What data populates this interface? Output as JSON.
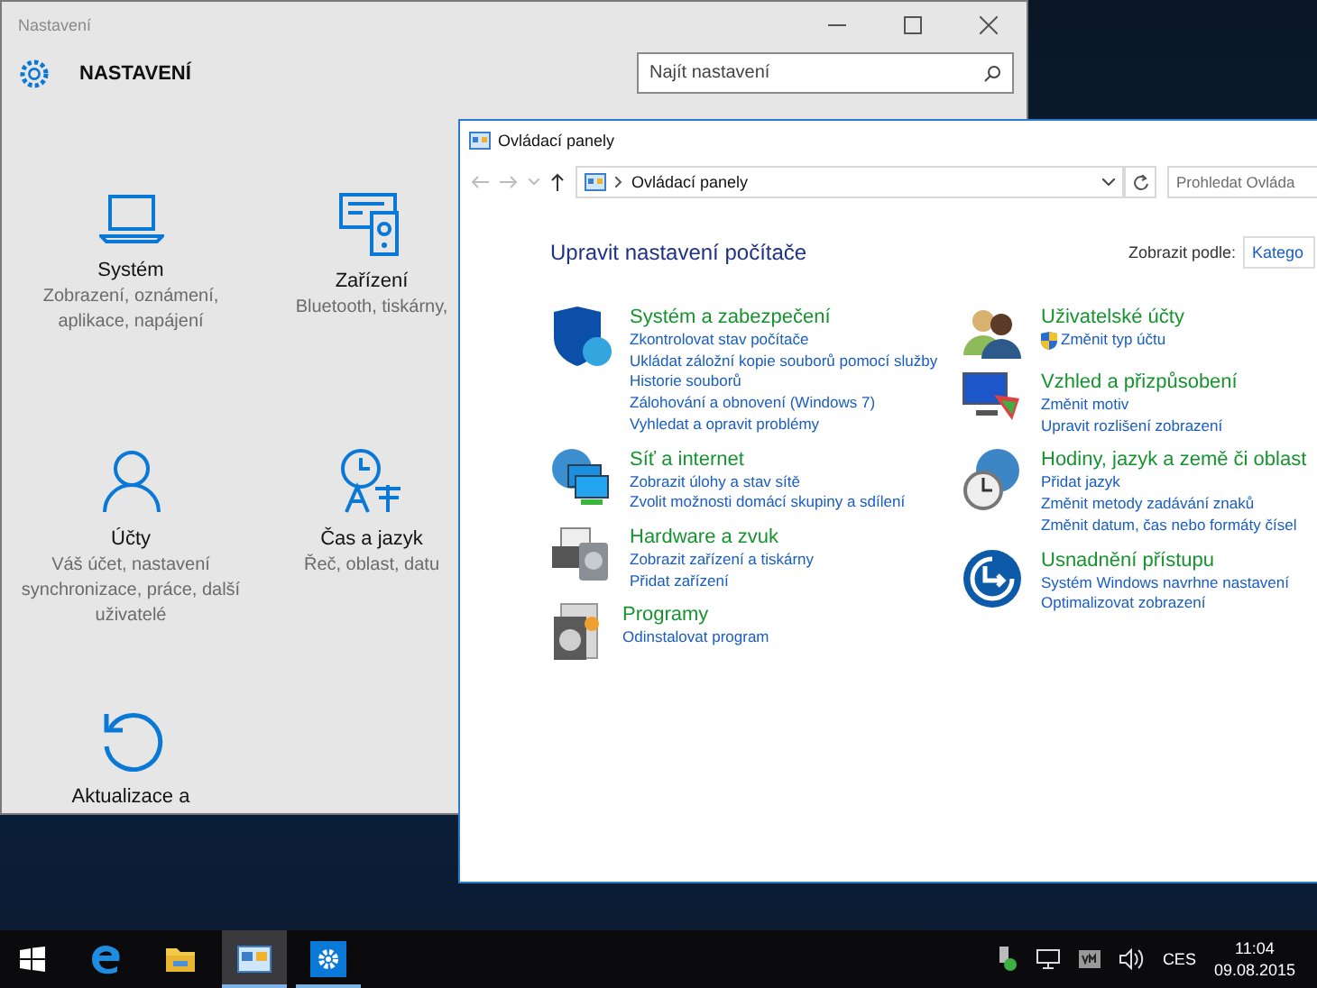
{
  "settings_window": {
    "title": "Nastavení",
    "header_title": "NASTAVENÍ",
    "search_placeholder": "Najít nastavení",
    "tiles": [
      {
        "title": "Systém",
        "description": "Zobrazení, oznámení, aplikace, napájení"
      },
      {
        "title": "Zařízení",
        "description": "Bluetooth, tiskárny,"
      },
      {
        "title": "Účty",
        "description": "Váš účet, nastavení synchronizace, práce, další uživatelé"
      },
      {
        "title": "Čas a jazyk",
        "description": "Řeč, oblast, datu"
      },
      {
        "title": "Aktualizace a"
      }
    ]
  },
  "control_panel": {
    "title": "Ovládací panely",
    "address": "Ovládací panely",
    "search_placeholder": "Prohledat Ovláda",
    "heading": "Upravit nastavení počítače",
    "view_label": "Zobrazit podle:",
    "view_value": "Katego",
    "columns": [
      [
        {
          "title": "Systém a zabezpečení",
          "links": [
            "Zkontrolovat stav počítače",
            "Ukládat záložní kopie souborů pomocí služby",
            "Historie souborů",
            "Zálohování a obnovení (Windows 7)",
            "Vyhledat a opravit problémy"
          ]
        },
        {
          "title": "Síť a internet",
          "links": [
            "Zobrazit úlohy a stav sítě",
            "Zvolit možnosti domácí skupiny a sdílení"
          ]
        },
        {
          "title": "Hardware a zvuk",
          "links": [
            "Zobrazit zařízení a tiskárny",
            "Přidat zařízení"
          ]
        },
        {
          "title": "Programy",
          "links": [
            "Odinstalovat program"
          ]
        }
      ],
      [
        {
          "title": "Uživatelské účty",
          "shield_first_link": true,
          "links": [
            "Změnit typ účtu"
          ]
        },
        {
          "title": "Vzhled a přizpůsobení",
          "links": [
            "Změnit motiv",
            "Upravit rozlišení zobrazení"
          ]
        },
        {
          "title": "Hodiny, jazyk a země či oblast",
          "links": [
            "Přidat jazyk",
            "Změnit metody zadávání znaků",
            "Změnit datum, čas nebo formáty čísel"
          ]
        },
        {
          "title": "Usnadnění přístupu",
          "links": [
            "Systém Windows navrhne nastavení",
            "Optimalizovat zobrazení"
          ]
        }
      ]
    ]
  },
  "taskbar": {
    "apps": [
      {
        "running": false,
        "selected": false
      },
      {
        "running": false,
        "selected": false
      },
      {
        "running": true,
        "selected": true
      },
      {
        "running": true,
        "selected": false
      }
    ],
    "language": "CES",
    "time": "11:04",
    "date": "09.08.2015"
  }
}
